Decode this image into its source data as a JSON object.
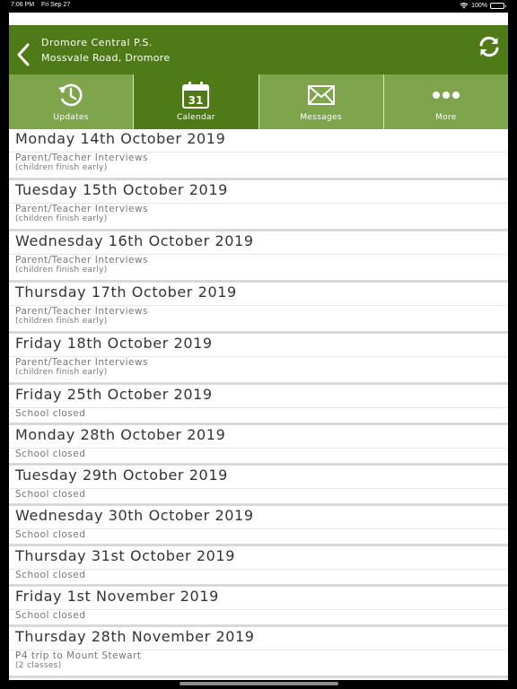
{
  "status_bar": {
    "time": "7:06 PM",
    "date": "Fri Sep 27",
    "battery": "100%"
  },
  "header": {
    "title": "Dromore Central P.S.",
    "subtitle": "Mossvale Road, Dromore"
  },
  "tabs": [
    {
      "label": "Updates",
      "icon": "clock-refresh-icon",
      "active": false
    },
    {
      "label": "Calendar",
      "icon": "calendar-icon",
      "calendar_day": "31",
      "active": true
    },
    {
      "label": "Messages",
      "icon": "envelope-icon",
      "active": false
    },
    {
      "label": "More",
      "icon": "more-dots-icon",
      "active": false
    }
  ],
  "events": [
    {
      "date": "Monday 14th October 2019",
      "title": "Parent/Teacher Interviews",
      "note": "(children finish early)"
    },
    {
      "date": "Tuesday 15th October 2019",
      "title": "Parent/Teacher Interviews",
      "note": "(children finish early)"
    },
    {
      "date": "Wednesday 16th October 2019",
      "title": "Parent/Teacher Interviews",
      "note": "(children finish early)"
    },
    {
      "date": "Thursday 17th October 2019",
      "title": "Parent/Teacher Interviews",
      "note": "(children finish early)"
    },
    {
      "date": "Friday 18th October 2019",
      "title": "Parent/Teacher Interviews",
      "note": "(children finish early)"
    },
    {
      "date": "Friday 25th October 2019",
      "title": "School closed",
      "note": ""
    },
    {
      "date": "Monday 28th October 2019",
      "title": "School closed",
      "note": ""
    },
    {
      "date": "Tuesday 29th October 2019",
      "title": "School closed",
      "note": ""
    },
    {
      "date": "Wednesday 30th October 2019",
      "title": "School closed",
      "note": ""
    },
    {
      "date": "Thursday 31st October 2019",
      "title": "School closed",
      "note": ""
    },
    {
      "date": "Friday 1st November 2019",
      "title": "School closed",
      "note": ""
    },
    {
      "date": "Thursday 28th November 2019",
      "title": "P4 trip to Mount Stewart",
      "note": "(2 classes)"
    }
  ],
  "colors": {
    "header": "#4e7a17",
    "tab": "#7ea44c",
    "tab_active": "#4e7a17"
  }
}
